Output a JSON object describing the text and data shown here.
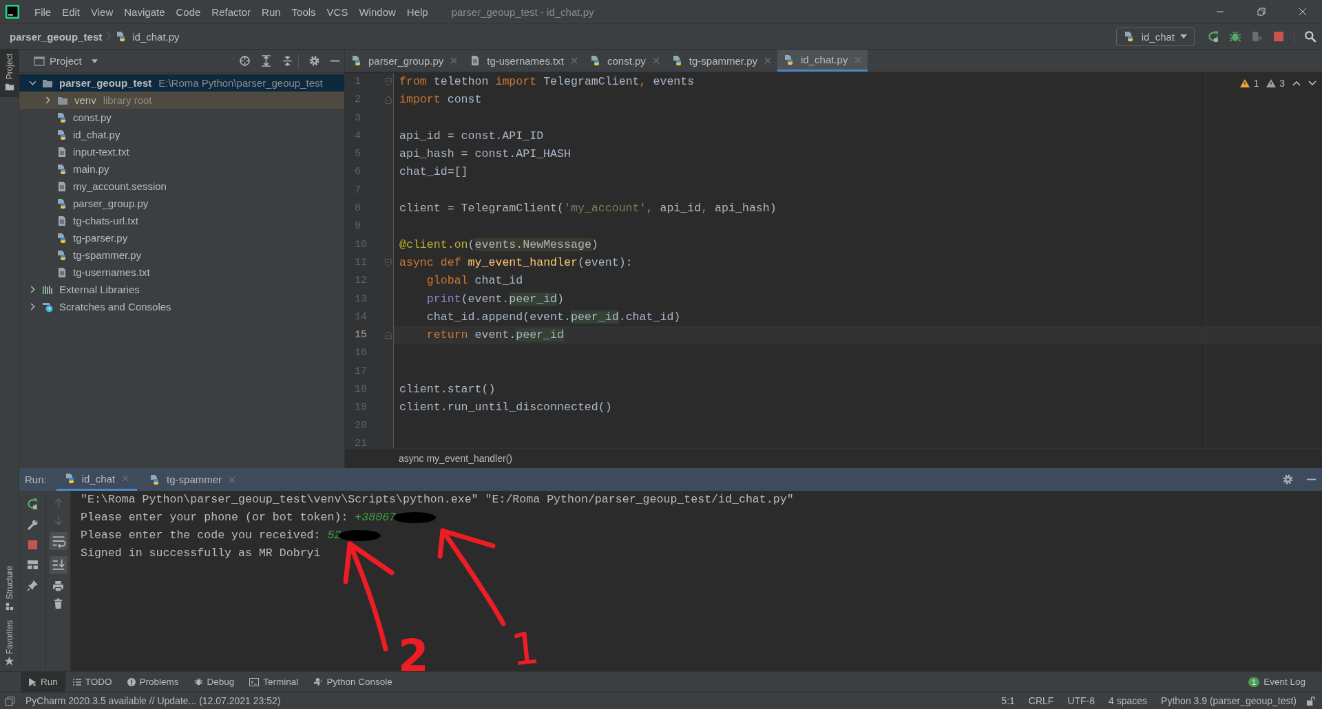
{
  "window": {
    "title": "parser_geoup_test - id_chat.py"
  },
  "menu": [
    "File",
    "Edit",
    "View",
    "Navigate",
    "Code",
    "Refactor",
    "Run",
    "Tools",
    "VCS",
    "Window",
    "Help"
  ],
  "navigation": {
    "project": "parser_geoup_test",
    "file": "id_chat.py",
    "run_config": "id_chat"
  },
  "side_stripe": {
    "top": "Project",
    "bottom": [
      "Structure",
      "Favorites"
    ]
  },
  "project_panel": {
    "title": "Project",
    "tree": [
      {
        "name": "parser_geoup_test",
        "note": "E:\\Roma Python\\parser_geoup_test",
        "kind": "folder",
        "expanded": true,
        "selected": true,
        "children": [
          {
            "name": "venv",
            "note": "library root",
            "kind": "library_folder",
            "expanded": false,
            "selected": false
          },
          {
            "name": "const.py",
            "kind": "python",
            "selected": false
          },
          {
            "name": "id_chat.py",
            "kind": "python",
            "selected": false
          },
          {
            "name": "input-text.txt",
            "kind": "text",
            "selected": false
          },
          {
            "name": "main.py",
            "kind": "python",
            "selected": false
          },
          {
            "name": "my_account.session",
            "kind": "text",
            "selected": false
          },
          {
            "name": "parser_group.py",
            "kind": "python",
            "selected": false
          },
          {
            "name": "tg-chats-url.txt",
            "kind": "text",
            "selected": false
          },
          {
            "name": "tg-parser.py",
            "kind": "python",
            "selected": false
          },
          {
            "name": "tg-spammer.py",
            "kind": "python",
            "selected": false
          },
          {
            "name": "tg-usernames.txt",
            "kind": "text",
            "selected": false
          }
        ]
      },
      {
        "name": "External Libraries",
        "kind": "libraries",
        "expanded": false,
        "selected": false
      },
      {
        "name": "Scratches and Consoles",
        "kind": "scratches",
        "expanded": false,
        "selected": false
      }
    ]
  },
  "editor_tabs": [
    {
      "label": "parser_group.py",
      "kind": "python",
      "selected": false
    },
    {
      "label": "tg-usernames.txt",
      "kind": "text",
      "selected": false
    },
    {
      "label": "const.py",
      "kind": "python",
      "selected": false
    },
    {
      "label": "tg-spammer.py",
      "kind": "python",
      "selected": false
    },
    {
      "label": "id_chat.py",
      "kind": "python",
      "selected": true
    }
  ],
  "inspections": {
    "warnings": "1",
    "weak_warnings": "3"
  },
  "code": [
    {
      "number": "1",
      "current": false,
      "fold": {
        "kind": "start"
      },
      "tokens": [
        {
          "t": "from",
          "kind": "kw"
        },
        {
          "t": " telethon ",
          "kind": "txt"
        },
        {
          "t": "import",
          "kind": "kw"
        },
        {
          "t": " TelegramClient",
          "kind": "txt"
        },
        {
          "t": ",",
          "kind": "kw"
        },
        {
          "t": " events",
          "kind": "txt"
        }
      ]
    },
    {
      "number": "2",
      "current": false,
      "fold": {
        "kind": "end"
      },
      "tokens": [
        {
          "t": "import",
          "kind": "kw"
        },
        {
          "t": " const",
          "kind": "txt"
        }
      ]
    },
    {
      "number": "3",
      "current": false
    },
    {
      "number": "4",
      "current": false,
      "tokens": [
        {
          "t": "api_id = const.API_ID",
          "kind": "txt"
        }
      ]
    },
    {
      "number": "5",
      "current": false,
      "tokens": [
        {
          "t": "api_hash = const.API_HASH",
          "kind": "txt"
        }
      ]
    },
    {
      "number": "6",
      "current": false,
      "tokens": [
        {
          "t": "chat_id=[]",
          "kind": "txt"
        }
      ]
    },
    {
      "number": "7",
      "current": false
    },
    {
      "number": "8",
      "current": false,
      "tokens": [
        {
          "t": "client = TelegramClient(",
          "kind": "txt"
        },
        {
          "t": "'my_account'",
          "kind": "str"
        },
        {
          "t": ",",
          "kind": "kw"
        },
        {
          "t": " api_id",
          "kind": "txt"
        },
        {
          "t": ",",
          "kind": "kw"
        },
        {
          "t": " api_hash)",
          "kind": "txt"
        }
      ]
    },
    {
      "number": "9",
      "current": false
    },
    {
      "number": "10",
      "current": false,
      "tokens": [
        {
          "t": "@client.on",
          "kind": "dec"
        },
        {
          "t": "(",
          "kind": "txt"
        },
        {
          "t": "events.NewMessage",
          "kind": "hl2"
        },
        {
          "t": ")",
          "kind": "txt"
        }
      ]
    },
    {
      "number": "11",
      "current": false,
      "fold": {
        "kind": "start"
      },
      "tokens": [
        {
          "t": "async def ",
          "kind": "kw"
        },
        {
          "t": "my_event_handler",
          "kind": "fn"
        },
        {
          "t": "(event):",
          "kind": "txt"
        }
      ]
    },
    {
      "number": "12",
      "current": false,
      "tokens": [
        {
          "t": "    global",
          "kind": "kw"
        },
        {
          "t": " chat_id",
          "kind": "txt"
        }
      ]
    },
    {
      "number": "13",
      "current": false,
      "tokens": [
        {
          "t": "    print",
          "kind": "builtin"
        },
        {
          "t": "(event.",
          "kind": "txt"
        },
        {
          "t": "peer_id",
          "kind": "hl"
        },
        {
          "t": ")",
          "kind": "txt"
        }
      ]
    },
    {
      "number": "14",
      "current": false,
      "tokens": [
        {
          "t": "    chat_id.append(event.",
          "kind": "txt"
        },
        {
          "t": "peer_id",
          "kind": "hl"
        },
        {
          "t": ".chat_id)",
          "kind": "txt"
        }
      ]
    },
    {
      "number": "15",
      "current": true,
      "fold": {
        "kind": "end"
      },
      "tokens": [
        {
          "t": "    return",
          "kind": "kw"
        },
        {
          "t": " event.",
          "kind": "txt"
        },
        {
          "t": "peer_id",
          "kind": "hl"
        }
      ]
    },
    {
      "number": "16",
      "current": false
    },
    {
      "number": "17",
      "current": false
    },
    {
      "number": "18",
      "current": false,
      "tokens": [
        {
          "t": "client.start()",
          "kind": "txt"
        }
      ]
    },
    {
      "number": "19",
      "current": false,
      "tokens": [
        {
          "t": "client.run_until_disconnected()",
          "kind": "txt"
        }
      ]
    },
    {
      "number": "20",
      "current": false
    },
    {
      "number": "21",
      "current": false
    }
  ],
  "editor_breadcrumb": "async my_event_handler()",
  "run_panel": {
    "label": "Run:",
    "tabs": [
      {
        "label": "id_chat",
        "selected": true
      },
      {
        "label": "tg-spammer",
        "selected": false
      }
    ],
    "console": [
      {
        "text": "\"E:\\Roma Python\\parser_geoup_test\\venv\\Scripts\\python.exe\" \"E:/Roma Python/parser_geoup_test/id_chat.py\"",
        "redacted": false
      },
      {
        "text": "Please enter your phone (or bot token): ",
        "input": "+38067",
        "redacted": true
      },
      {
        "text": "Please enter the code you received: ",
        "input": "52",
        "redacted": true
      },
      {
        "text": "Signed in successfully as MR Dobryi",
        "redacted": false
      }
    ]
  },
  "annotations": [
    {
      "label": "1"
    },
    {
      "label": "2"
    }
  ],
  "tool_tabs": [
    {
      "label": "Run",
      "kind": "run",
      "selected": true
    },
    {
      "label": "TODO",
      "kind": "todo",
      "selected": false
    },
    {
      "label": "Problems",
      "kind": "problems",
      "selected": false
    },
    {
      "label": "Debug",
      "kind": "debug",
      "selected": false
    },
    {
      "label": "Terminal",
      "kind": "terminal",
      "selected": false
    },
    {
      "label": "Python Console",
      "kind": "console",
      "selected": false
    }
  ],
  "event_log": {
    "label": "Event Log",
    "count": "1"
  },
  "status_bar": {
    "message": "PyCharm 2020.3.5 available // Update... (12.07.2021 23:52)",
    "items": [
      "5:1",
      "CRLF",
      "UTF-8",
      "4 spaces",
      "Python 3.9 (parser_geoup_test)"
    ]
  }
}
